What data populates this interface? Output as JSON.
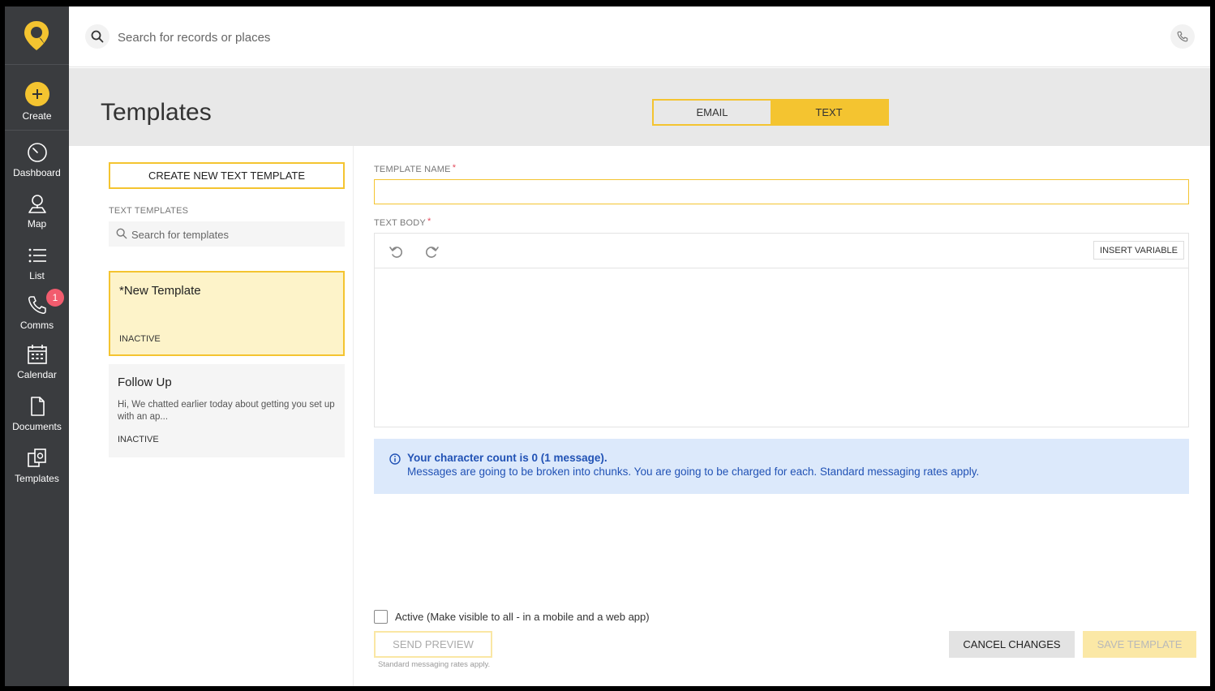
{
  "sidebar": {
    "logo": "location-pin-logo",
    "create_label": "Create",
    "items": [
      {
        "label": "Dashboard",
        "icon": "dashboard-gauge-icon"
      },
      {
        "label": "Map",
        "icon": "map-person-pin-icon"
      },
      {
        "label": "List",
        "icon": "list-icon"
      },
      {
        "label": "Comms",
        "icon": "phone-icon",
        "badge": "1"
      },
      {
        "label": "Calendar",
        "icon": "calendar-icon"
      },
      {
        "label": "Documents",
        "icon": "document-icon"
      },
      {
        "label": "Templates",
        "icon": "templates-icon"
      }
    ]
  },
  "topbar": {
    "search_placeholder": "Search for records or places"
  },
  "header": {
    "title": "Templates",
    "tabs": [
      {
        "label": "EMAIL",
        "active": false
      },
      {
        "label": "TEXT",
        "active": true
      }
    ]
  },
  "left_panel": {
    "create_button": "CREATE NEW TEXT TEMPLATE",
    "section_label": "TEXT TEMPLATES",
    "search_placeholder": "Search for templates",
    "templates": [
      {
        "title": "*New Template",
        "preview": "",
        "status": "INACTIVE",
        "selected": true
      },
      {
        "title": "Follow Up",
        "preview": "Hi, We chatted earlier today about getting you set up with an ap...",
        "status": "INACTIVE",
        "selected": false
      }
    ]
  },
  "form": {
    "name_label": "TEMPLATE NAME",
    "name_value": "",
    "body_label": "TEXT BODY",
    "required_mark": "*",
    "insert_variable": "INSERT VARIABLE",
    "body_value": "",
    "info_line1": "Your character count is 0 (1 message).",
    "info_line2": "Messages are going to be broken into chunks. You are going to be charged for each. Standard messaging rates apply.",
    "active_label": "Active (Make visible to all - in a mobile and a web app)",
    "send_preview": "SEND PREVIEW",
    "preview_note": "Standard messaging rates apply.",
    "cancel": "CANCEL CHANGES",
    "save": "SAVE TEMPLATE"
  },
  "colors": {
    "accent": "#f4c430",
    "sidebar_bg": "#3a3c3f",
    "info_bg": "#dce9fb",
    "info_text": "#2152b5",
    "badge": "#f25c6e"
  }
}
